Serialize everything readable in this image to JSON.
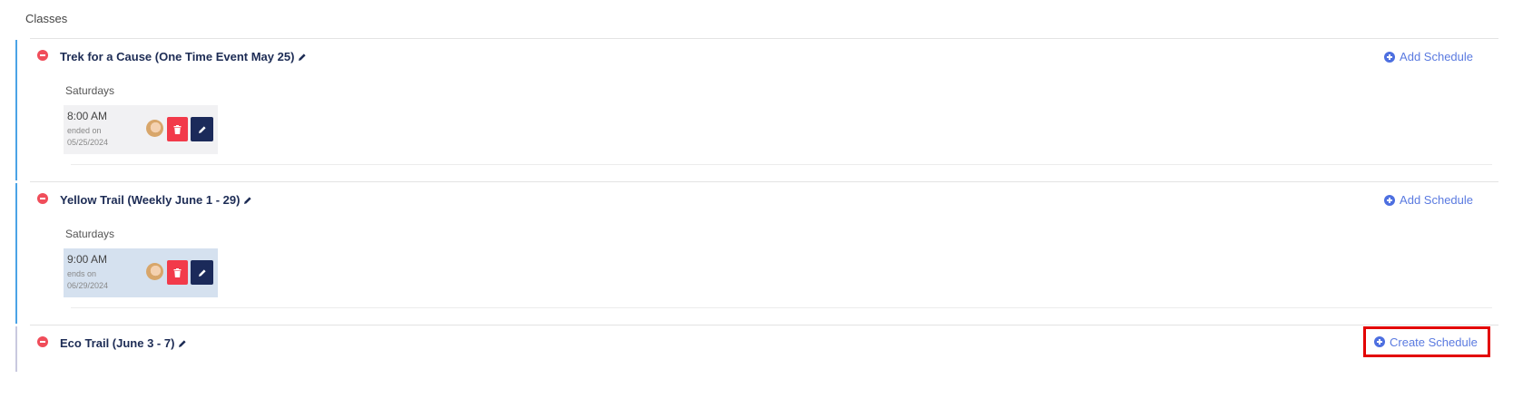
{
  "section_title": "Classes",
  "classes": [
    {
      "name": "Trek for a Cause (One Time Event May 25)",
      "action_label": "Add Schedule",
      "day": "Saturdays",
      "slot": {
        "time": "8:00 AM",
        "status": "ended on",
        "date": "05/25/2024"
      }
    },
    {
      "name": "Yellow Trail (Weekly June 1 - 29)",
      "action_label": "Add Schedule",
      "day": "Saturdays",
      "slot": {
        "time": "9:00 AM",
        "status": "ends on",
        "date": "06/29/2024"
      }
    },
    {
      "name": "Eco Trail (June 3 - 7)",
      "action_label": "Create Schedule"
    }
  ],
  "colors": {
    "accent_blue": "#4aa3e6",
    "link_blue": "#5a7ae0",
    "delete_red": "#f23a4a",
    "edit_navy": "#1b2a5a",
    "highlight_box": "#e30000"
  },
  "icons": {
    "remove": "minus-circle-icon",
    "edit": "pencil-icon",
    "add": "plus-circle-icon",
    "delete": "trash-icon"
  }
}
